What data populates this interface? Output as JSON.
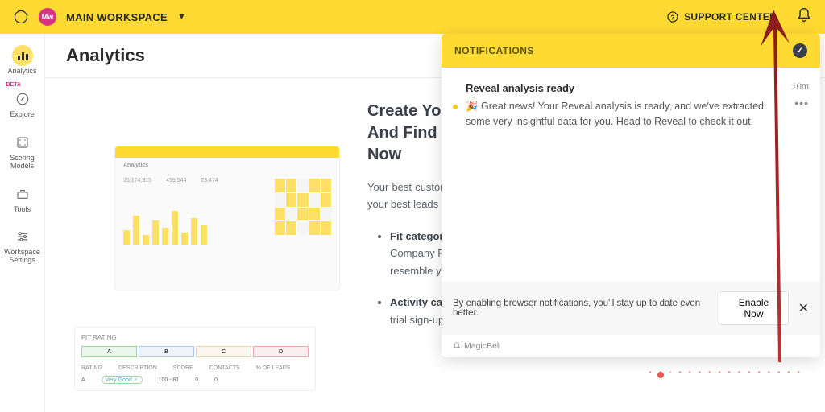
{
  "topbar": {
    "workspace_badge": "Mw",
    "workspace_name": "MAIN WORKSPACE",
    "support": "SUPPORT CENTER"
  },
  "sidebar": {
    "items": [
      {
        "label": "Analytics"
      },
      {
        "label": "Explore",
        "beta": "BETA"
      },
      {
        "label": "Scoring Models"
      },
      {
        "label": "Tools"
      },
      {
        "label": "Workspace Settings"
      }
    ]
  },
  "page": {
    "title": "Analytics",
    "hero_title": "Create Your First Model\nAnd Find Your Best Leads\nNow",
    "hero_p": "Your best customers are only a few clicks away! Create your first Scoring Model and uncover your best leads now using Breadcrumbs' data.",
    "bullet1_b": "Fit categories",
    "bullet1": " leverage firmographic data such as Industry, Company Size, Job Title, Company Revenue, and more to score your contacts based on how closely they resemble your ideal customer.",
    "bullet2_b": "Activity categories",
    "bullet2": " leverage engagement data such as email opens, page views, and trial sign-ups to uncover which of your contacts are the most engaged."
  },
  "mock": {
    "title": "Analytics",
    "fit": "FIT RATING",
    "h1": "RATING",
    "h2": "DESCRIPTION",
    "h3": "SCORE",
    "h4": "CONTACTS",
    "h5": "% OF LEADS",
    "s1": "100 - 81",
    "s2": "0",
    "s3": "0"
  },
  "notif": {
    "header": "NOTIFICATIONS",
    "item_title": "Reveal analysis ready",
    "item_text": "🎉 Great news! Your Reveal analysis is ready, and we've extracted some very insightful data for you. Head to Reveal to check it out.",
    "item_time": "10m",
    "item_more": "•••",
    "footer_text": "By enabling browser notifications, you'll stay up to date even better.",
    "enable": "Enable Now",
    "powered": "MagicBell"
  }
}
